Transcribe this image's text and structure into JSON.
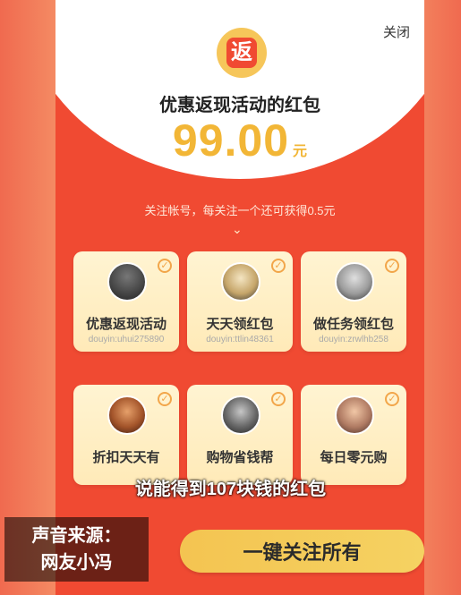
{
  "modal": {
    "close_label": "关闭",
    "coin_glyph": "返",
    "subtitle": "优惠返现活动的红包",
    "amount": "99.00",
    "amount_unit": "元",
    "note": "关注帐号，每关注一个还可获得0.5元",
    "chevron": "⌄",
    "cta_label": "一键关注所有"
  },
  "accounts": [
    {
      "name": "优惠返现活动",
      "handle": "douyin:uhui275890",
      "checked": true
    },
    {
      "name": "天天领红包",
      "handle": "douyin:ttlin48361",
      "checked": true
    },
    {
      "name": "做任务领红包",
      "handle": "douyin:zrwlhb258",
      "checked": true
    },
    {
      "name": "折扣天天有",
      "handle": "",
      "checked": true
    },
    {
      "name": "购物省钱帮",
      "handle": "",
      "checked": true
    },
    {
      "name": "每日零元购",
      "handle": "",
      "checked": true
    }
  ],
  "overlay": {
    "caption": "说能得到107块钱的红包",
    "source_line1": "声音来源：",
    "source_line2": "网友小冯"
  },
  "colors": {
    "accent_red": "#f04a32",
    "gold": "#f2b636",
    "cta_yellow": "#f4c451"
  }
}
